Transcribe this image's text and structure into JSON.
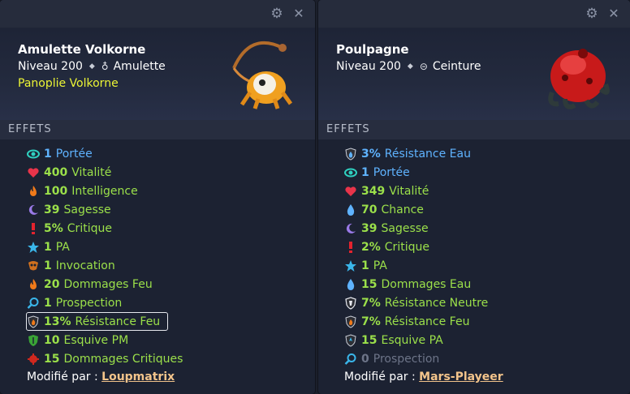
{
  "left": {
    "name": "Amulette Volkorne",
    "level": "Niveau 200",
    "type": "Amulette",
    "set": "Panoplie Volkorne",
    "effects_title": "EFFETS",
    "effects": [
      {
        "value": "1",
        "label": "Portée",
        "color": "#5fb3ff",
        "icon": "eye-icon"
      },
      {
        "value": "400",
        "label": "Vitalité",
        "color": "#9be04a",
        "icon": "heart-icon"
      },
      {
        "value": "100",
        "label": "Intelligence",
        "color": "#9be04a",
        "icon": "fire-icon"
      },
      {
        "value": "39",
        "label": "Sagesse",
        "color": "#9be04a",
        "icon": "moon-icon"
      },
      {
        "value": "5%",
        "label": "Critique",
        "color": "#9be04a",
        "icon": "exclamation-icon"
      },
      {
        "value": "1",
        "label": "PA",
        "color": "#9be04a",
        "icon": "star-icon"
      },
      {
        "value": "1",
        "label": "Invocation",
        "color": "#9be04a",
        "icon": "summon-icon"
      },
      {
        "value": "20",
        "label": "Dommages Feu",
        "color": "#9be04a",
        "icon": "fire-icon"
      },
      {
        "value": "1",
        "label": "Prospection",
        "color": "#9be04a",
        "icon": "magnifier-icon"
      },
      {
        "value": "13%",
        "label": "Résistance Feu",
        "color": "#9be04a",
        "icon": "fire-shield-icon"
      },
      {
        "value": "10",
        "label": "Esquive PM",
        "color": "#9be04a",
        "icon": "green-shield-icon"
      },
      {
        "value": "15",
        "label": "Dommages Critiques",
        "color": "#9be04a",
        "icon": "critical-damage-icon"
      }
    ],
    "modified_by_label": "Modifié par :",
    "modified_by_user": "Loupmatrix"
  },
  "right": {
    "name": "Poulpagne",
    "level": "Niveau 200",
    "type": "Ceinture",
    "effects_title": "EFFETS",
    "effects": [
      {
        "value": "3%",
        "label": "Résistance Eau",
        "color": "#5fb3ff",
        "icon": "water-shield-icon"
      },
      {
        "value": "1",
        "label": "Portée",
        "color": "#5fb3ff",
        "icon": "eye-icon"
      },
      {
        "value": "349",
        "label": "Vitalité",
        "color": "#9be04a",
        "icon": "heart-icon"
      },
      {
        "value": "70",
        "label": "Chance",
        "color": "#9be04a",
        "icon": "water-drop-icon"
      },
      {
        "value": "39",
        "label": "Sagesse",
        "color": "#9be04a",
        "icon": "moon-icon"
      },
      {
        "value": "2%",
        "label": "Critique",
        "color": "#9be04a",
        "icon": "exclamation-icon"
      },
      {
        "value": "1",
        "label": "PA",
        "color": "#9be04a",
        "icon": "star-icon"
      },
      {
        "value": "15",
        "label": "Dommages Eau",
        "color": "#9be04a",
        "icon": "water-drop-icon"
      },
      {
        "value": "7%",
        "label": "Résistance Neutre",
        "color": "#9be04a",
        "icon": "neutral-shield-icon"
      },
      {
        "value": "7%",
        "label": "Résistance Feu",
        "color": "#9be04a",
        "icon": "fire-shield-icon"
      },
      {
        "value": "15",
        "label": "Esquive PA",
        "color": "#9be04a",
        "icon": "blue-shield-icon"
      },
      {
        "value": "0",
        "label": "Prospection",
        "color": "#6d7488",
        "icon": "magnifier-icon"
      }
    ],
    "modified_by_label": "Modifié par :",
    "modified_by_user": "Mars-Playeer"
  },
  "colors": {
    "panel_bg": "#1c2232",
    "set_yellow": "#ecf535",
    "effect_green": "#9be04a",
    "effect_blue": "#5fb3ff",
    "link_orange": "#f3c48b",
    "muted": "#6d7488"
  }
}
